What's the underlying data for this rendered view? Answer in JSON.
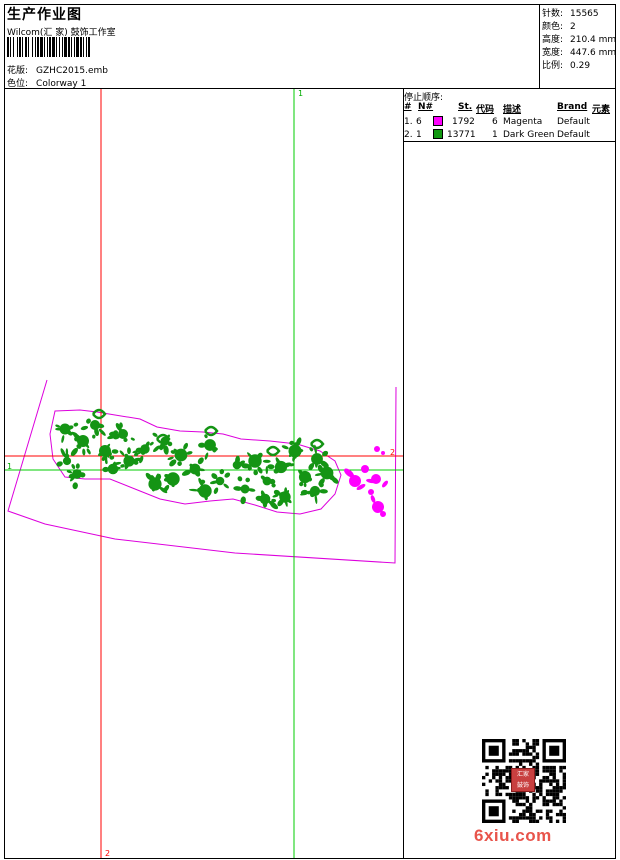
{
  "header": {
    "title": "生产作业图",
    "studio": "Wilcom(汇 家) 鼓饰工作室",
    "design_label": "花版:",
    "design_file": "GZHC2015.emb",
    "colorway_label": "色位:",
    "colorway": "Colorway 1"
  },
  "stats": [
    {
      "label": "针数:",
      "value": "15565"
    },
    {
      "label": "颜色:",
      "value": "2"
    },
    {
      "label": "高度:",
      "value": "210.4 mm"
    },
    {
      "label": "宽度:",
      "value": "447.6 mm"
    },
    {
      "label": "比例:",
      "value": "0.29"
    }
  ],
  "color_table": {
    "title": "停止顺序:",
    "headers": [
      "#",
      "N#",
      "St.",
      "代码",
      "描述",
      "Brand",
      "元素"
    ],
    "rows": [
      {
        "seq": "1.",
        "n": "6",
        "color": "#ff00ff",
        "stitches": "1792",
        "code": "6",
        "desc": "Magenta",
        "brand": "Default"
      },
      {
        "seq": "2.",
        "n": "1",
        "color": "#119911",
        "stitches": "13771",
        "code": "1",
        "desc": "Dark Green",
        "brand": "Default"
      }
    ]
  },
  "guides": {
    "h_label": "1",
    "h_label_end": "2",
    "v_green_label": "1",
    "v_red_label": "2",
    "red_color": "#ff0000",
    "green_color": "#00cc00"
  },
  "design": {
    "outline_color": "#dd00dd",
    "green": "#149414",
    "magenta": "#ff00ff"
  },
  "seal_text": "汇家\n鼓饰",
  "watermark": "6xiu.com"
}
